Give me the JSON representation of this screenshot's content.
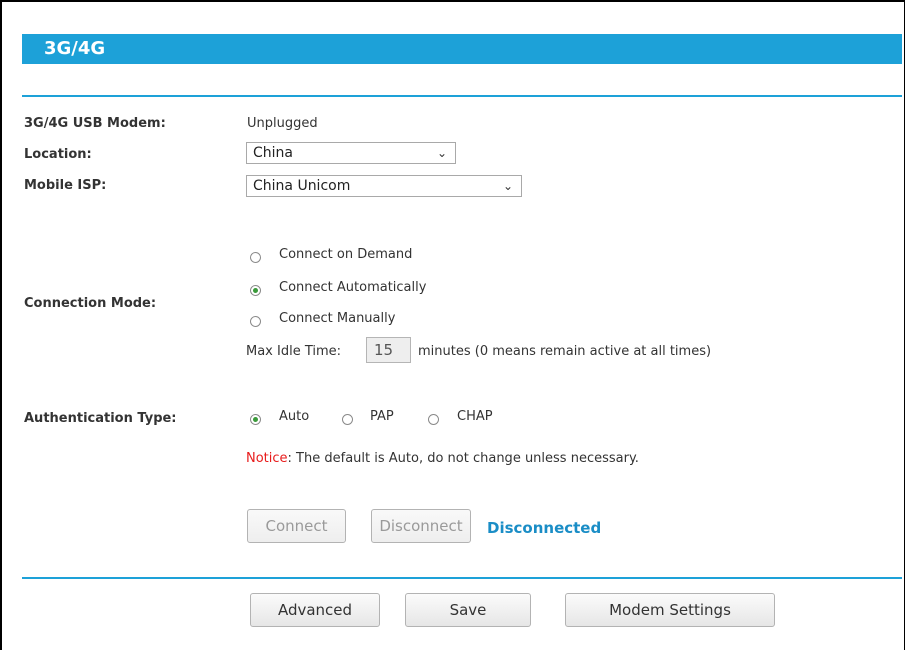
{
  "header": {
    "title": "3G/4G"
  },
  "fields": {
    "modem_label": "3G/4G USB Modem:",
    "modem_value": "Unplugged",
    "location_label": "Location:",
    "location_value": "China",
    "isp_label": "Mobile ISP:",
    "isp_value": "China Unicom"
  },
  "connection_mode": {
    "label": "Connection Mode:",
    "options": [
      "Connect on Demand",
      "Connect Automatically",
      "Connect Manually"
    ],
    "selected": "Connect Automatically",
    "max_idle_label": "Max Idle Time:",
    "max_idle_value": "15",
    "max_idle_suffix": "minutes (0 means remain active at all times)"
  },
  "auth": {
    "label": "Authentication Type:",
    "options": [
      "Auto",
      "PAP",
      "CHAP"
    ],
    "selected": "Auto",
    "notice_prefix": "Notice",
    "notice_text": ": The default is Auto, do not change unless necessary."
  },
  "connection": {
    "connect_label": "Connect",
    "disconnect_label": "Disconnect",
    "status": "Disconnected"
  },
  "footer_buttons": {
    "advanced": "Advanced",
    "save": "Save",
    "modem_settings": "Modem Settings"
  },
  "colors": {
    "accent": "#1da1d8",
    "status": "#1a8dc6",
    "notice": "#e81c1c",
    "radio_selected": "#3a9a3a"
  },
  "icons": {
    "select_arrow": "chevron-down-icon",
    "radio": "radio-button-icon"
  }
}
